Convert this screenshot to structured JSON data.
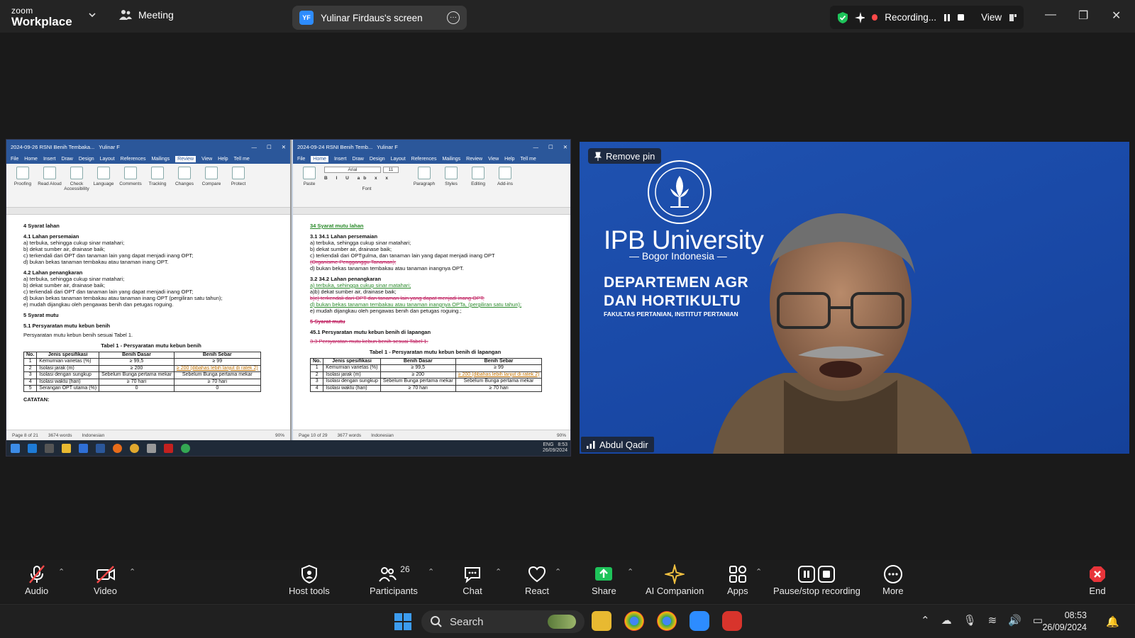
{
  "app": {
    "brand_small": "zoom",
    "brand_big": "Workplace",
    "meeting_label": "Meeting"
  },
  "share_pill": {
    "initials": "YF",
    "label": "Yulinar Firdaus's screen"
  },
  "recording": {
    "label": "Recording...",
    "view_label": "View"
  },
  "shared_screen": {
    "left_doc": {
      "title": "2024-09-26 RSNI Benih Tembaka...",
      "user": "Yulinar F",
      "active_tab": "Review",
      "tabs": [
        "File",
        "Home",
        "Insert",
        "Draw",
        "Design",
        "Layout",
        "References",
        "Mailings",
        "Review",
        "View",
        "Help",
        "Tell me"
      ],
      "ribbon": [
        "Proofing",
        "Read Aloud",
        "Check Accessibility",
        "Language",
        "Comments",
        "Tracking",
        "Changes",
        "Compare",
        "Protect"
      ],
      "lines": {
        "h4": "4    Syarat lahan",
        "h41": "4.1 Lahan persemaian",
        "a1": "a)   terbuka, sehingga cukup sinar matahari;",
        "b1": "b)   dekat sumber air, drainase baik;",
        "c1": "c)   terkendali dari OPT dan tanaman lain yang dapat menjadi inang OPT;",
        "d1": "d)   bukan bekas tanaman tembakau atau tanaman inang OPT.",
        "h42": "4.2 Lahan penangkaran",
        "a2": "a)   terbuka, sehingga cukup sinar matahari;",
        "b2": "b)   dekat sumber air, drainase baik;",
        "c2": "c)   terkendali dari OPT dan tanaman lain yang dapat menjadi inang OPT;",
        "d2": "d)   bukan bekas tanaman tembakau atau tanaman inang OPT (pergiliran satu tahun);",
        "e2": "e)   mudah dijangkau oleh pengawas benih dan petugas roguing.",
        "h5": "5    Syarat mutu",
        "h51": "5.1 Persyaratan mutu kebun benih",
        "p51": "Persyaratan mutu kebun benih sesuai Tabel 1.",
        "tcap": "Tabel 1 - Persyaratan mutu kebun benih",
        "catatan": "CATATAN:"
      },
      "table": {
        "headers": [
          "No.",
          "Jenis spesifikasi",
          "Benih Dasar",
          "Benih Sebar"
        ],
        "rows": [
          [
            "1",
            "Kemurnian varietas (%)",
            "≥ 99,5",
            "≥ 99"
          ],
          [
            "2",
            "Isolasi jarak (m)",
            "≥ 200",
            "≥ 200 (dibahas lebih lanjut di ratek 2)"
          ],
          [
            "3",
            "Isolasi dengan sungkup",
            "Sebelum Bunga pertama mekar",
            "Sebelum Bunga pertama mekar"
          ],
          [
            "4",
            "Isolasi waktu (hari)",
            "≥ 70 hari",
            "≥ 70 hari"
          ],
          [
            "5",
            "Serangan OPT utama (%)",
            "0",
            "0"
          ]
        ]
      },
      "status": {
        "page": "Page 8 of 21",
        "words": "3674 words",
        "lang": "Indonesian",
        "zoom": "90%"
      }
    },
    "right_doc": {
      "title": "2024-09-24 RSNI Benih Temb...",
      "user": "Yulinar F",
      "active_tab": "Home",
      "tabs": [
        "File",
        "Home",
        "Insert",
        "Draw",
        "Design",
        "Layout",
        "References",
        "Mailings",
        "Review",
        "View",
        "Help",
        "Tell me"
      ],
      "ribbon": [
        "Paste",
        "Font",
        "Paragraph",
        "Styles",
        "Editing",
        "Add-ins"
      ],
      "font_name": "Arial",
      "font_size": "11",
      "lines": {
        "h4": "34  Syarat mutu lahan",
        "h41": "3.1    34.1 Lahan persemaian",
        "a1": "a)   terbuka, sehingga cukup sinar matahari;",
        "b1": "b)   dekat sumber air, drainase baik;",
        "c1": "c)   terkendali dari OPTgulma, dan tanaman lain yang dapat menjadi inang OPT",
        "c1b": "(Organisme Pengganggu Tanaman);",
        "d1": "d)   bukan bekas tanaman tembakau atau tanaman inangnya OPT.",
        "h42": "3.2    34.2 Lahan penangkaran",
        "a2": "a)   terbuka, sehingga cukup sinar matahari;",
        "b2": "a)b) dekat sumber air, drainase baik;",
        "c2": "b)c) terkendali dari OPT dan tanaman lain yang dapat menjadi inang OPT;",
        "d2": "d)   bukan bekas tanaman tembakau atau tanaman inangnya OPTa, (pergiliran satu tahun);",
        "e2": "e)   mudah dijangkau oleh pengawas benih dan petugas roguing.;",
        "h5": "5    Syarat mutu",
        "h51": "45.1 Persyaratan mutu kebun benih di lapangan",
        "p51": "3.3       Persyaratan mutu kebun benih sesuai Tabel 1.",
        "tcap": "Tabel 1 - Persyaratan mutu kebun benih di lapangan"
      },
      "table": {
        "headers": [
          "No.",
          "Jenis spesifikasi",
          "Benih Dasar",
          "Benih Sebar"
        ],
        "rows": [
          [
            "1",
            "Kemurnian varietas (%)",
            "≥ 99,5",
            "≥ 99"
          ],
          [
            "2",
            "Isolasi jarak (m)",
            "≥ 200",
            "≥ 200 (dibahas lebih lanjut di ratek 2)"
          ],
          [
            "3",
            "Isolasi dengan sungkup",
            "Sebelum Bunga pertama mekar",
            "Sebelum Bunga pertama mekar"
          ],
          [
            "4",
            "Isolasi waktu (hari)",
            "≥ 70 hari",
            "≥ 70 hari"
          ]
        ]
      },
      "status": {
        "page": "Page 10 of 29",
        "words": "3677 words",
        "lang": "Indonesian",
        "zoom": "90%"
      }
    },
    "win_taskbar": {
      "lang": "ENG",
      "time": "8:53",
      "date": "26/09/2024"
    }
  },
  "video": {
    "remove_pin": "Remove pin",
    "ipb": "IPB University",
    "bogor": "— Bogor Indonesia —",
    "dept1": "DEPARTEMEN AGR",
    "dept2": "DAN HORTIKULTU",
    "faculty": "FAKULTAS PERTANIAN, INSTITUT PERTANIAN",
    "participant_name": "Abdul Qadir"
  },
  "toolbar": {
    "audio": "Audio",
    "video": "Video",
    "host_tools": "Host tools",
    "participants": "Participants",
    "participants_count": "26",
    "chat": "Chat",
    "react": "React",
    "share": "Share",
    "ai": "AI Companion",
    "apps": "Apps",
    "pause": "Pause/stop recording",
    "more": "More",
    "end": "End"
  },
  "taskbar": {
    "search": "Search",
    "time": "08:53",
    "date": "26/09/2024"
  },
  "colors": {
    "zoom_blue": "#2d8cff",
    "share_green": "#1ec35a",
    "end_red": "#e8343a",
    "ipb_blue": "#1d4ba6"
  }
}
